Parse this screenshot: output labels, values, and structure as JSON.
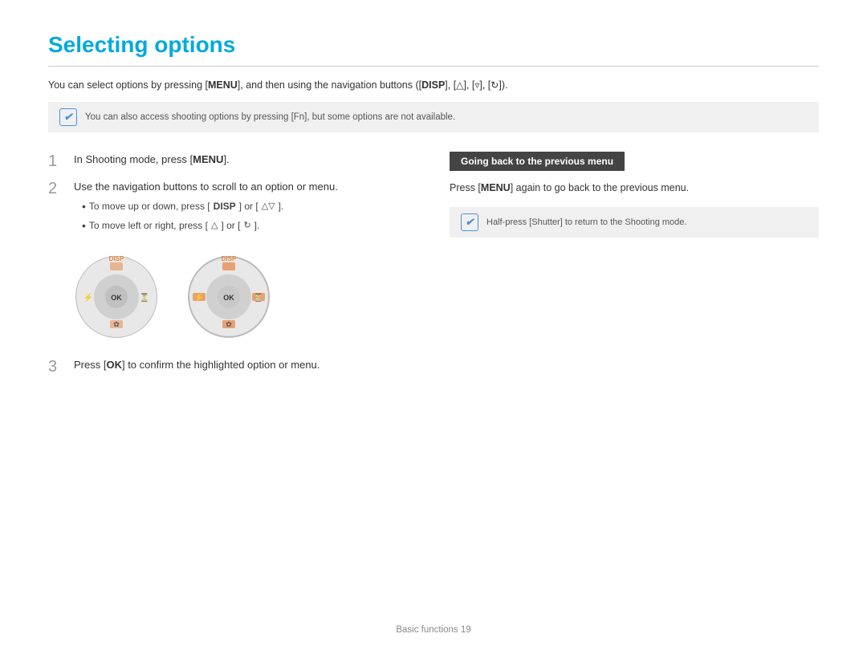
{
  "page": {
    "title": "Selecting options",
    "footer": "Basic functions  19"
  },
  "intro": {
    "text_before": "You can select options by pressing [",
    "menu_key": "MENU",
    "text_middle": "], and then using the navigation buttons ([",
    "disp_key": "DISP",
    "text_end": "], [▲▼], [◄►], [☼])."
  },
  "note1": {
    "text": "You can also access shooting options by pressing [Fn], but some options are not available."
  },
  "steps": [
    {
      "number": "1",
      "text_before": "In Shooting mode, press [",
      "key": "MENU",
      "text_after": "]."
    },
    {
      "number": "2",
      "text": "Use the navigation buttons to scroll to an option or menu.",
      "bullets": [
        "To move up or down, press [DISP] or [▲▼].",
        "To move left or right, press [◄►] or [☼]."
      ]
    },
    {
      "number": "3",
      "text_before": "Press [",
      "key": "OK",
      "text_after": "] to confirm the highlighted option or menu."
    }
  ],
  "sidebar": {
    "heading": "Going back to the previous menu",
    "text_before": "Press [",
    "key": "MENU",
    "text_after": "] again to go back to the previous menu.",
    "note_text": "Half-press [Shutter] to return to the Shooting mode."
  },
  "dial1": {
    "label": "DISP",
    "buttons": [
      "left",
      "ok",
      "right",
      "up",
      "down"
    ]
  },
  "dial2": {
    "label": "DISP",
    "buttons": [
      "left",
      "ok",
      "right",
      "up",
      "down"
    ],
    "highlighted": true
  }
}
